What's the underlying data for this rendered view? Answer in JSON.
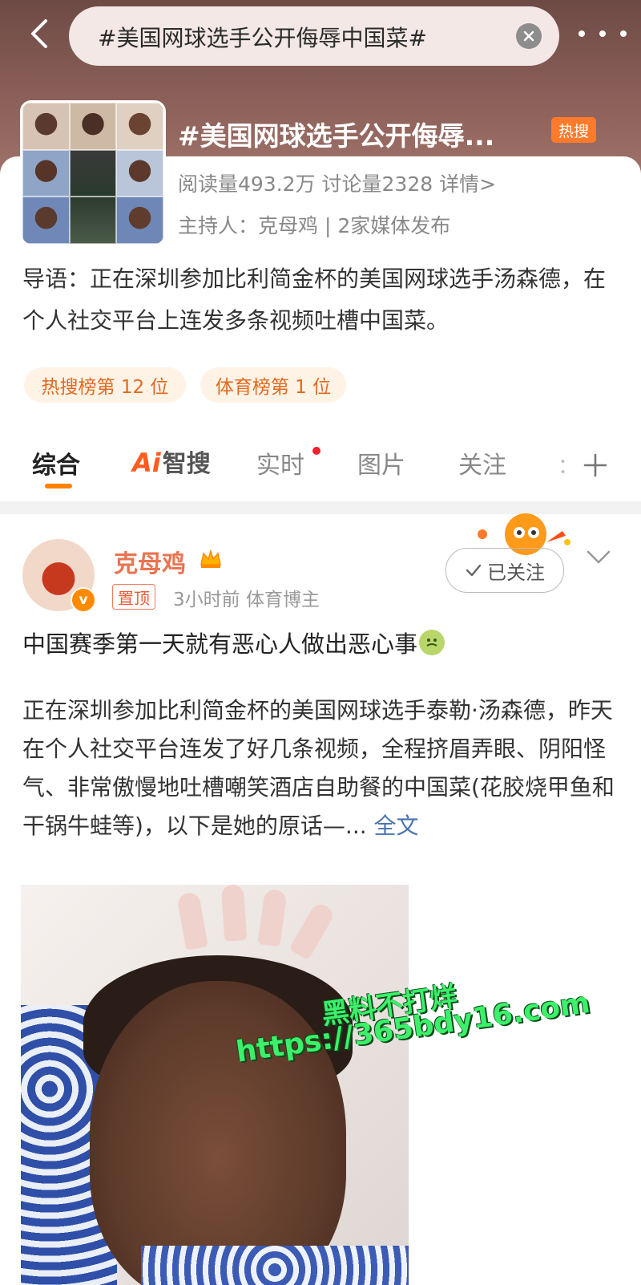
{
  "nav": {
    "search_text": "#美国网球选手公开侮辱中国菜#"
  },
  "topic": {
    "title": "#美国网球选手公开侮辱...",
    "hot_badge": "热搜",
    "stats": "阅读量493.2万  讨论量2328  详情>",
    "host": "主持人：克母鸡 | 2家媒体发布",
    "intro": "导语：正在深圳参加比利简金杯的美国网球选手汤森德，在个人社交平台上连发多条视频吐槽中国菜。",
    "ranks": [
      "热搜榜第 12 位",
      "体育榜第 1 位"
    ]
  },
  "tabs": {
    "items": [
      "综合",
      "智搜",
      "实时",
      "图片",
      "关注"
    ],
    "ai_prefix": "Ai",
    "more": "："
  },
  "post": {
    "username": "克母鸡",
    "pin_label": "置顶",
    "meta": "3小时前   体育博主",
    "follow_label": "已关注",
    "headline": "中国赛季第一天就有恶心人做出恶心事",
    "body": "正在深圳参加比利简金杯的美国网球选手泰勒·汤森德，昨天在个人社交平台连发了好几条视频，全程挤眉弄眼、阴阳怪气、非常傲慢地吐槽嘲笑酒店自助餐的中国菜(花胶烧甲鱼和干锅牛蛙等)，以下是她的原话—... ",
    "fulltext_link": "全文",
    "watermark_line1": "黑料不打烊",
    "watermark_line2": "https://365bdy16.com"
  },
  "colors": {
    "accent": "#ff8200",
    "username": "#eb7350",
    "link": "#4a72b0",
    "hot": "#ff7a2a"
  },
  "icons": [
    "back-arrow-icon",
    "clear-icon",
    "more-dots-icon",
    "plus-icon",
    "crown-icon",
    "check-icon",
    "chevron-down-icon",
    "nausea-face-icon"
  ]
}
